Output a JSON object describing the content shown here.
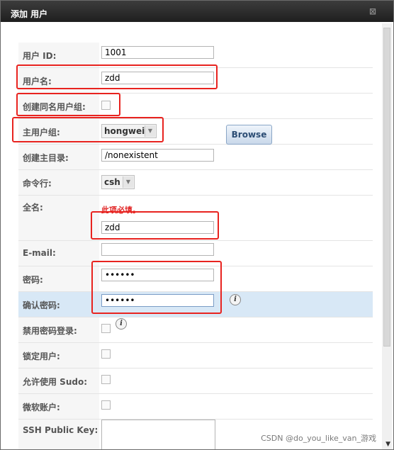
{
  "dialog": {
    "title": "添加 用户",
    "close_glyph": "⊠"
  },
  "form": {
    "user_id": {
      "label": "用户 ID:",
      "value": "1001"
    },
    "username": {
      "label": "用户名:",
      "value": "zdd"
    },
    "create_group": {
      "label": "创建同名用户组:"
    },
    "primary_group": {
      "label": "主用户组:",
      "value": "hongwei"
    },
    "home_dir": {
      "label": "创建主目录:",
      "value": "/nonexistent",
      "browse_label": "Browse"
    },
    "shell": {
      "label": "命令行:",
      "value": "csh"
    },
    "full_name": {
      "label": "全名:",
      "required_msg": "此项必填。",
      "value": "zdd"
    },
    "email": {
      "label": "E-mail:",
      "value": ""
    },
    "password": {
      "label": "密码:",
      "value": "••••••"
    },
    "confirm_password": {
      "label": "确认密码:",
      "value": "••••••"
    },
    "disable_password_login": {
      "label": "禁用密码登录:"
    },
    "lock_user": {
      "label": "锁定用户:"
    },
    "allow_sudo": {
      "label": "允许使用 Sudo:"
    },
    "microsoft_account": {
      "label": "微软账户:"
    },
    "ssh_public_key": {
      "label": "SSH Public Key:"
    }
  },
  "icons": {
    "info": "i",
    "dropdown": "▼"
  },
  "watermark": "CSDN @do_you_like_van_游戏",
  "colors": {
    "annotation_red": "#e8231f",
    "required_red": "#e12222",
    "highlight_row": "#d8e8f6"
  }
}
